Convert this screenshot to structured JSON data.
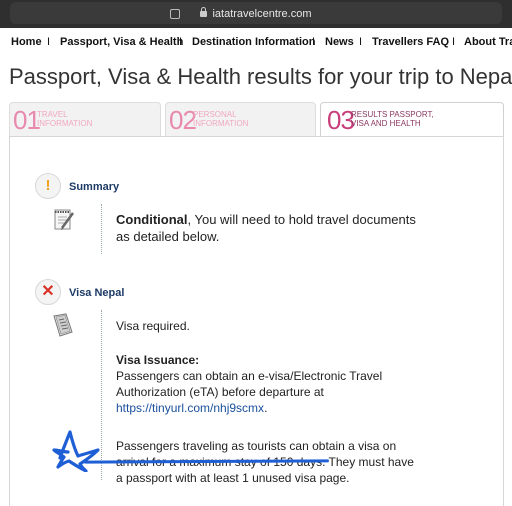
{
  "browser": {
    "url": "iatatravelcentre.com"
  },
  "nav": {
    "items": [
      "Home",
      "Passport, Visa & Health",
      "Destination Information",
      "News",
      "Travellers FAQ",
      "About Trav"
    ],
    "separator": "I"
  },
  "page_title": "Passport, Visa & Health results for your trip to Nepal",
  "steps": [
    {
      "num": "01",
      "label_1": "TRAVEL",
      "label_2": "INFORMATION"
    },
    {
      "num": "02",
      "label_1": "PERSONAL",
      "label_2": "INFORMATION"
    },
    {
      "num": "03",
      "label_1": "RESULTS PASSPORT,",
      "label_2": "VISA AND HEALTH"
    }
  ],
  "summary": {
    "title": "Summary",
    "badge": "!",
    "conditional_label": "Conditional",
    "conditional_text": ", You will need to hold travel documents",
    "conditional_text_2": "as detailed below."
  },
  "visa": {
    "title": "Visa Nepal",
    "badge": "✕",
    "required": "Visa required.",
    "issuance_title": "Visa Issuance:",
    "issuance_line1": "Passengers can obtain an e-visa/Electronic Travel",
    "issuance_line2": "Authorization (eTA) before departure at",
    "issuance_link": "https://tinyurl.com/nhj9scmx",
    "issuance_link_end": ".",
    "tourist_line1": "Passengers traveling as tourists can obtain a visa on",
    "tourist_line2": "arrival for a maximum stay of 150 days. They must have",
    "tourist_line3": "a passport with at least 1 unused visa page."
  },
  "colors": {
    "accent_pink": "#c83d7a",
    "title_blue": "#1d3b66",
    "annotation_blue": "#1f5fd6"
  }
}
